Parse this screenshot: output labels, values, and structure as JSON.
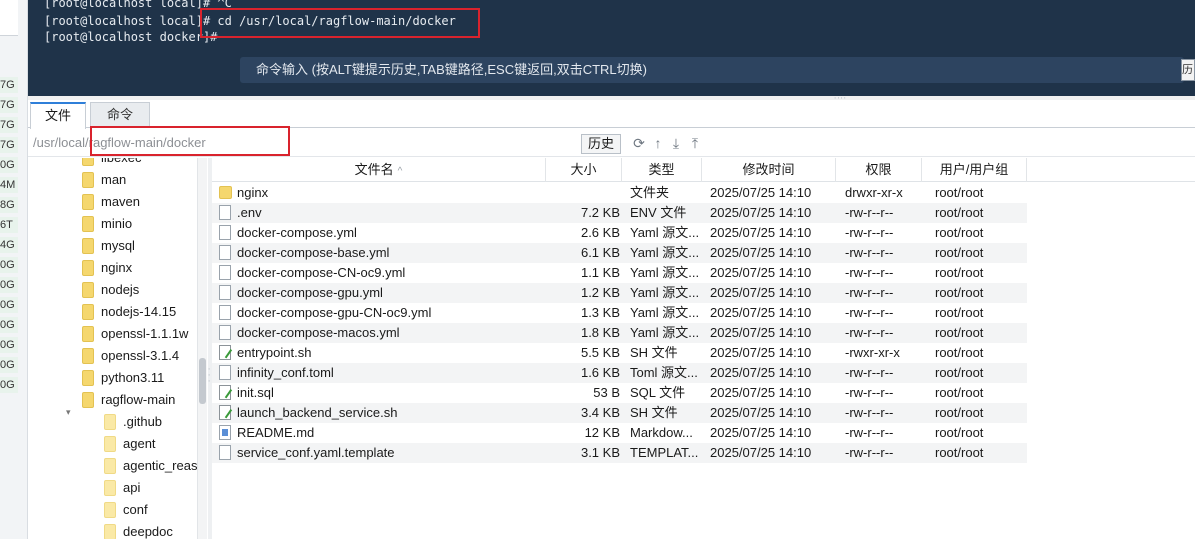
{
  "left_strip": {
    "sizes": [
      "7G",
      "7G",
      "7G",
      "7G",
      "0G",
      "4M",
      "8G",
      "6T",
      "4G",
      "0G",
      "0G",
      "0G",
      "0G",
      "0G",
      "0G",
      "0G"
    ]
  },
  "terminal": {
    "lines": [
      "[root@localhost local]# ^C",
      "[root@localhost local]# cd /usr/local/ragflow-main/docker",
      "[root@localhost docker]#"
    ],
    "command_bar_placeholder": "命令输入 (按ALT键提示历史,TAB键路径,ESC键返回,双击CTRL切换)",
    "command_bar_right": "历"
  },
  "tabs": [
    {
      "label": "文件",
      "active": true
    },
    {
      "label": "命令",
      "active": false
    }
  ],
  "path_bar": {
    "path": "/usr/local/ragflow-main/docker",
    "history_label": "历史",
    "icons": [
      "refresh-icon",
      "up-arrow-icon",
      "download-icon",
      "upload-icon"
    ]
  },
  "tree": {
    "items": [
      {
        "label": "libexec",
        "level": 0
      },
      {
        "label": "man",
        "level": 0
      },
      {
        "label": "maven",
        "level": 0
      },
      {
        "label": "minio",
        "level": 0
      },
      {
        "label": "mysql",
        "level": 0
      },
      {
        "label": "nginx",
        "level": 0
      },
      {
        "label": "nodejs",
        "level": 0
      },
      {
        "label": "nodejs-14.15",
        "level": 0
      },
      {
        "label": "openssl-1.1.1w",
        "level": 0
      },
      {
        "label": "openssl-3.1.4",
        "level": 0
      },
      {
        "label": "python3.11",
        "level": 0
      },
      {
        "label": "ragflow-main",
        "level": 0,
        "expanded": true
      },
      {
        "label": ".github",
        "level": 1
      },
      {
        "label": "agent",
        "level": 1
      },
      {
        "label": "agentic_reasc",
        "level": 1
      },
      {
        "label": "api",
        "level": 1
      },
      {
        "label": "conf",
        "level": 1
      },
      {
        "label": "deepdoc",
        "level": 1
      }
    ],
    "expanded_toggle": "▾"
  },
  "file_list": {
    "columns": {
      "name": "文件名",
      "size": "大小",
      "type": "类型",
      "modified": "修改时间",
      "perm": "权限",
      "owner": "用户/用户组"
    },
    "sort_arrow": "^",
    "rows": [
      {
        "name": "nginx",
        "size": "",
        "type": "文件夹",
        "modified": "2025/07/25 14:10",
        "perm": "drwxr-xr-x",
        "owner": "root/root",
        "icon": "folder"
      },
      {
        "name": ".env",
        "size": "7.2 KB",
        "type": "ENV 文件",
        "modified": "2025/07/25 14:10",
        "perm": "-rw-r--r--",
        "owner": "root/root",
        "icon": "doc"
      },
      {
        "name": "docker-compose.yml",
        "size": "2.6 KB",
        "type": "Yaml 源文...",
        "modified": "2025/07/25 14:10",
        "perm": "-rw-r--r--",
        "owner": "root/root",
        "icon": "doc"
      },
      {
        "name": "docker-compose-base.yml",
        "size": "6.1 KB",
        "type": "Yaml 源文...",
        "modified": "2025/07/25 14:10",
        "perm": "-rw-r--r--",
        "owner": "root/root",
        "icon": "doc"
      },
      {
        "name": "docker-compose-CN-oc9.yml",
        "size": "1.1 KB",
        "type": "Yaml 源文...",
        "modified": "2025/07/25 14:10",
        "perm": "-rw-r--r--",
        "owner": "root/root",
        "icon": "doc"
      },
      {
        "name": "docker-compose-gpu.yml",
        "size": "1.2 KB",
        "type": "Yaml 源文...",
        "modified": "2025/07/25 14:10",
        "perm": "-rw-r--r--",
        "owner": "root/root",
        "icon": "doc"
      },
      {
        "name": "docker-compose-gpu-CN-oc9.yml",
        "size": "1.3 KB",
        "type": "Yaml 源文...",
        "modified": "2025/07/25 14:10",
        "perm": "-rw-r--r--",
        "owner": "root/root",
        "icon": "doc"
      },
      {
        "name": "docker-compose-macos.yml",
        "size": "1.8 KB",
        "type": "Yaml 源文...",
        "modified": "2025/07/25 14:10",
        "perm": "-rw-r--r--",
        "owner": "root/root",
        "icon": "doc"
      },
      {
        "name": "entrypoint.sh",
        "size": "5.5 KB",
        "type": "SH 文件",
        "modified": "2025/07/25 14:10",
        "perm": "-rwxr-xr-x",
        "owner": "root/root",
        "icon": "script"
      },
      {
        "name": "infinity_conf.toml",
        "size": "1.6 KB",
        "type": "Toml 源文...",
        "modified": "2025/07/25 14:10",
        "perm": "-rw-r--r--",
        "owner": "root/root",
        "icon": "doc"
      },
      {
        "name": "init.sql",
        "size": "53 B",
        "type": "SQL 文件",
        "modified": "2025/07/25 14:10",
        "perm": "-rw-r--r--",
        "owner": "root/root",
        "icon": "script"
      },
      {
        "name": "launch_backend_service.sh",
        "size": "3.4 KB",
        "type": "SH 文件",
        "modified": "2025/07/25 14:10",
        "perm": "-rw-r--r--",
        "owner": "root/root",
        "icon": "script"
      },
      {
        "name": "README.md",
        "size": "12 KB",
        "type": "Markdow...",
        "modified": "2025/07/25 14:10",
        "perm": "-rw-r--r--",
        "owner": "root/root",
        "icon": "md"
      },
      {
        "name": "service_conf.yaml.template",
        "size": "3.1 KB",
        "type": "TEMPLAT...",
        "modified": "2025/07/25 14:10",
        "perm": "-rw-r--r--",
        "owner": "root/root",
        "icon": "doc"
      }
    ]
  },
  "colors": {
    "terminal_bg": "#1f3349",
    "highlight_border": "#d9232d",
    "accent": "#2f7fd9"
  }
}
